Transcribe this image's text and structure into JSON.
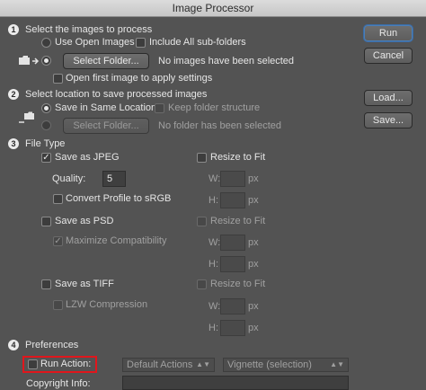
{
  "window": {
    "title": "Image Processor"
  },
  "colors": {
    "accent": "#4a7fb8",
    "highlight": "#e0161c",
    "background": "#535353"
  },
  "buttons": {
    "run": "Run",
    "cancel": "Cancel",
    "load": "Load...",
    "save": "Save..."
  },
  "section1": {
    "number": "1",
    "title": "Select the images to process",
    "use_open_images": "Use Open Images",
    "include_subfolders": "Include All sub-folders",
    "select_folder": "Select Folder...",
    "folder_status": "No images have been selected",
    "open_first_image": "Open first image to apply settings"
  },
  "section2": {
    "number": "2",
    "title": "Select location to save processed images",
    "save_same_location": "Save in Same Location",
    "keep_folder_structure": "Keep folder structure",
    "select_folder": "Select Folder...",
    "folder_status": "No folder has been selected"
  },
  "section3": {
    "number": "3",
    "title": "File Type",
    "jpeg": {
      "label": "Save as JPEG",
      "quality_label": "Quality:",
      "quality_value": "5",
      "convert_profile": "Convert Profile to sRGB",
      "resize": "Resize to Fit",
      "w_label": "W:",
      "h_label": "H:",
      "unit": "px"
    },
    "psd": {
      "label": "Save as PSD",
      "maximize": "Maximize Compatibility",
      "resize": "Resize to Fit",
      "w_label": "W:",
      "h_label": "H:",
      "unit": "px"
    },
    "tiff": {
      "label": "Save as TIFF",
      "lzw": "LZW Compression",
      "resize": "Resize to Fit",
      "w_label": "W:",
      "h_label": "H:",
      "unit": "px"
    }
  },
  "section4": {
    "number": "4",
    "title": "Preferences",
    "run_action": "Run Action:",
    "action_set": "Default Actions",
    "action_name": "Vignette (selection)",
    "copyright_label": "Copyright Info:"
  },
  "icons": {
    "checkmark": "✓",
    "chevron": "⌃⌄"
  }
}
